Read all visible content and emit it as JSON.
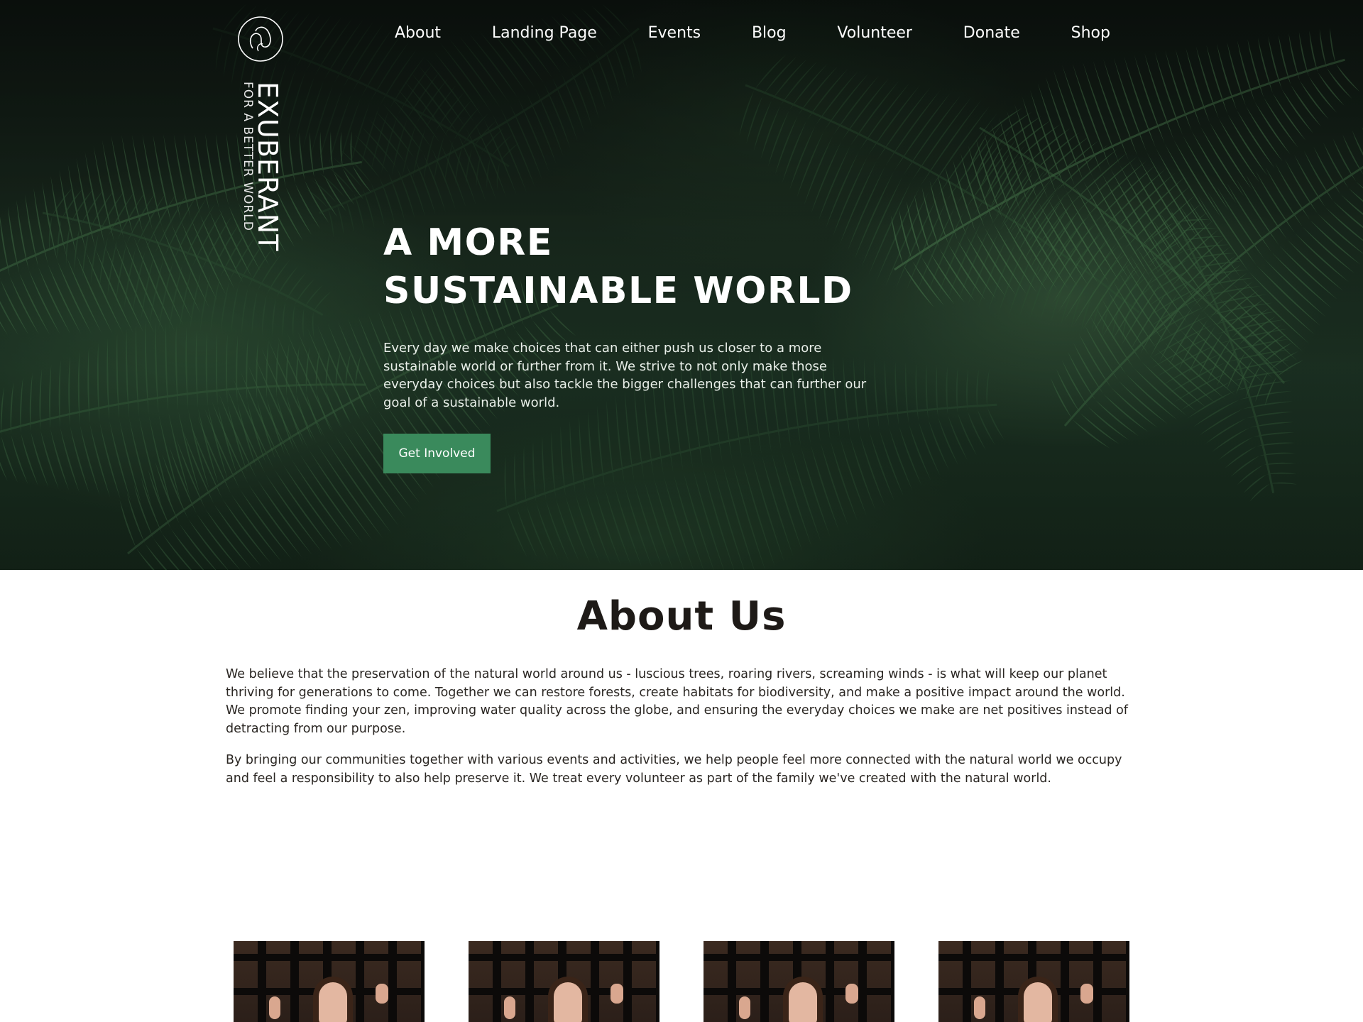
{
  "brand": {
    "name": "EXUBERANT",
    "tagline": "FOR A BETTER WORLD",
    "logo_icon": "logo-emblem-icon"
  },
  "nav": {
    "items": [
      {
        "label": "About"
      },
      {
        "label": "Landing Page"
      },
      {
        "label": "Events"
      },
      {
        "label": "Blog"
      },
      {
        "label": "Volunteer"
      },
      {
        "label": "Donate"
      },
      {
        "label": "Shop"
      }
    ]
  },
  "hero": {
    "title_line1": "A MORE",
    "title_line2": "SUSTAINABLE WORLD",
    "text": "Every day we make choices that can either push us closer to a more sustainable world or further from it. We strive to not only make those everyday choices but also tackle the bigger challenges that can further our goal of a sustainable world.",
    "cta_label": "Get Involved",
    "cta_color": "#3a8a5c"
  },
  "about": {
    "heading": "About Us",
    "paragraph1": "We believe that the preservation of the natural world around us - luscious trees, roaring rivers, screaming winds - is what will keep our planet thriving for generations to come. Together we can restore forests, create habitats for biodiversity, and make a positive impact around the world. We promote finding your zen, improving water quality across the globe, and ensuring the everyday choices we make are net positives instead of detracting from our purpose.",
    "paragraph2": "By bringing our communities together with various events and activities, we help people feel more connected with the natural world we occupy and feel a responsibility to also help preserve it. We treat every volunteer as part of the family we've created with the natural world."
  },
  "gallery": {
    "photos": [
      {
        "subject": "woman-behind-grate-photo"
      },
      {
        "subject": "woman-behind-grate-photo"
      },
      {
        "subject": "woman-behind-grate-photo"
      },
      {
        "subject": "woman-behind-grate-photo"
      }
    ]
  }
}
